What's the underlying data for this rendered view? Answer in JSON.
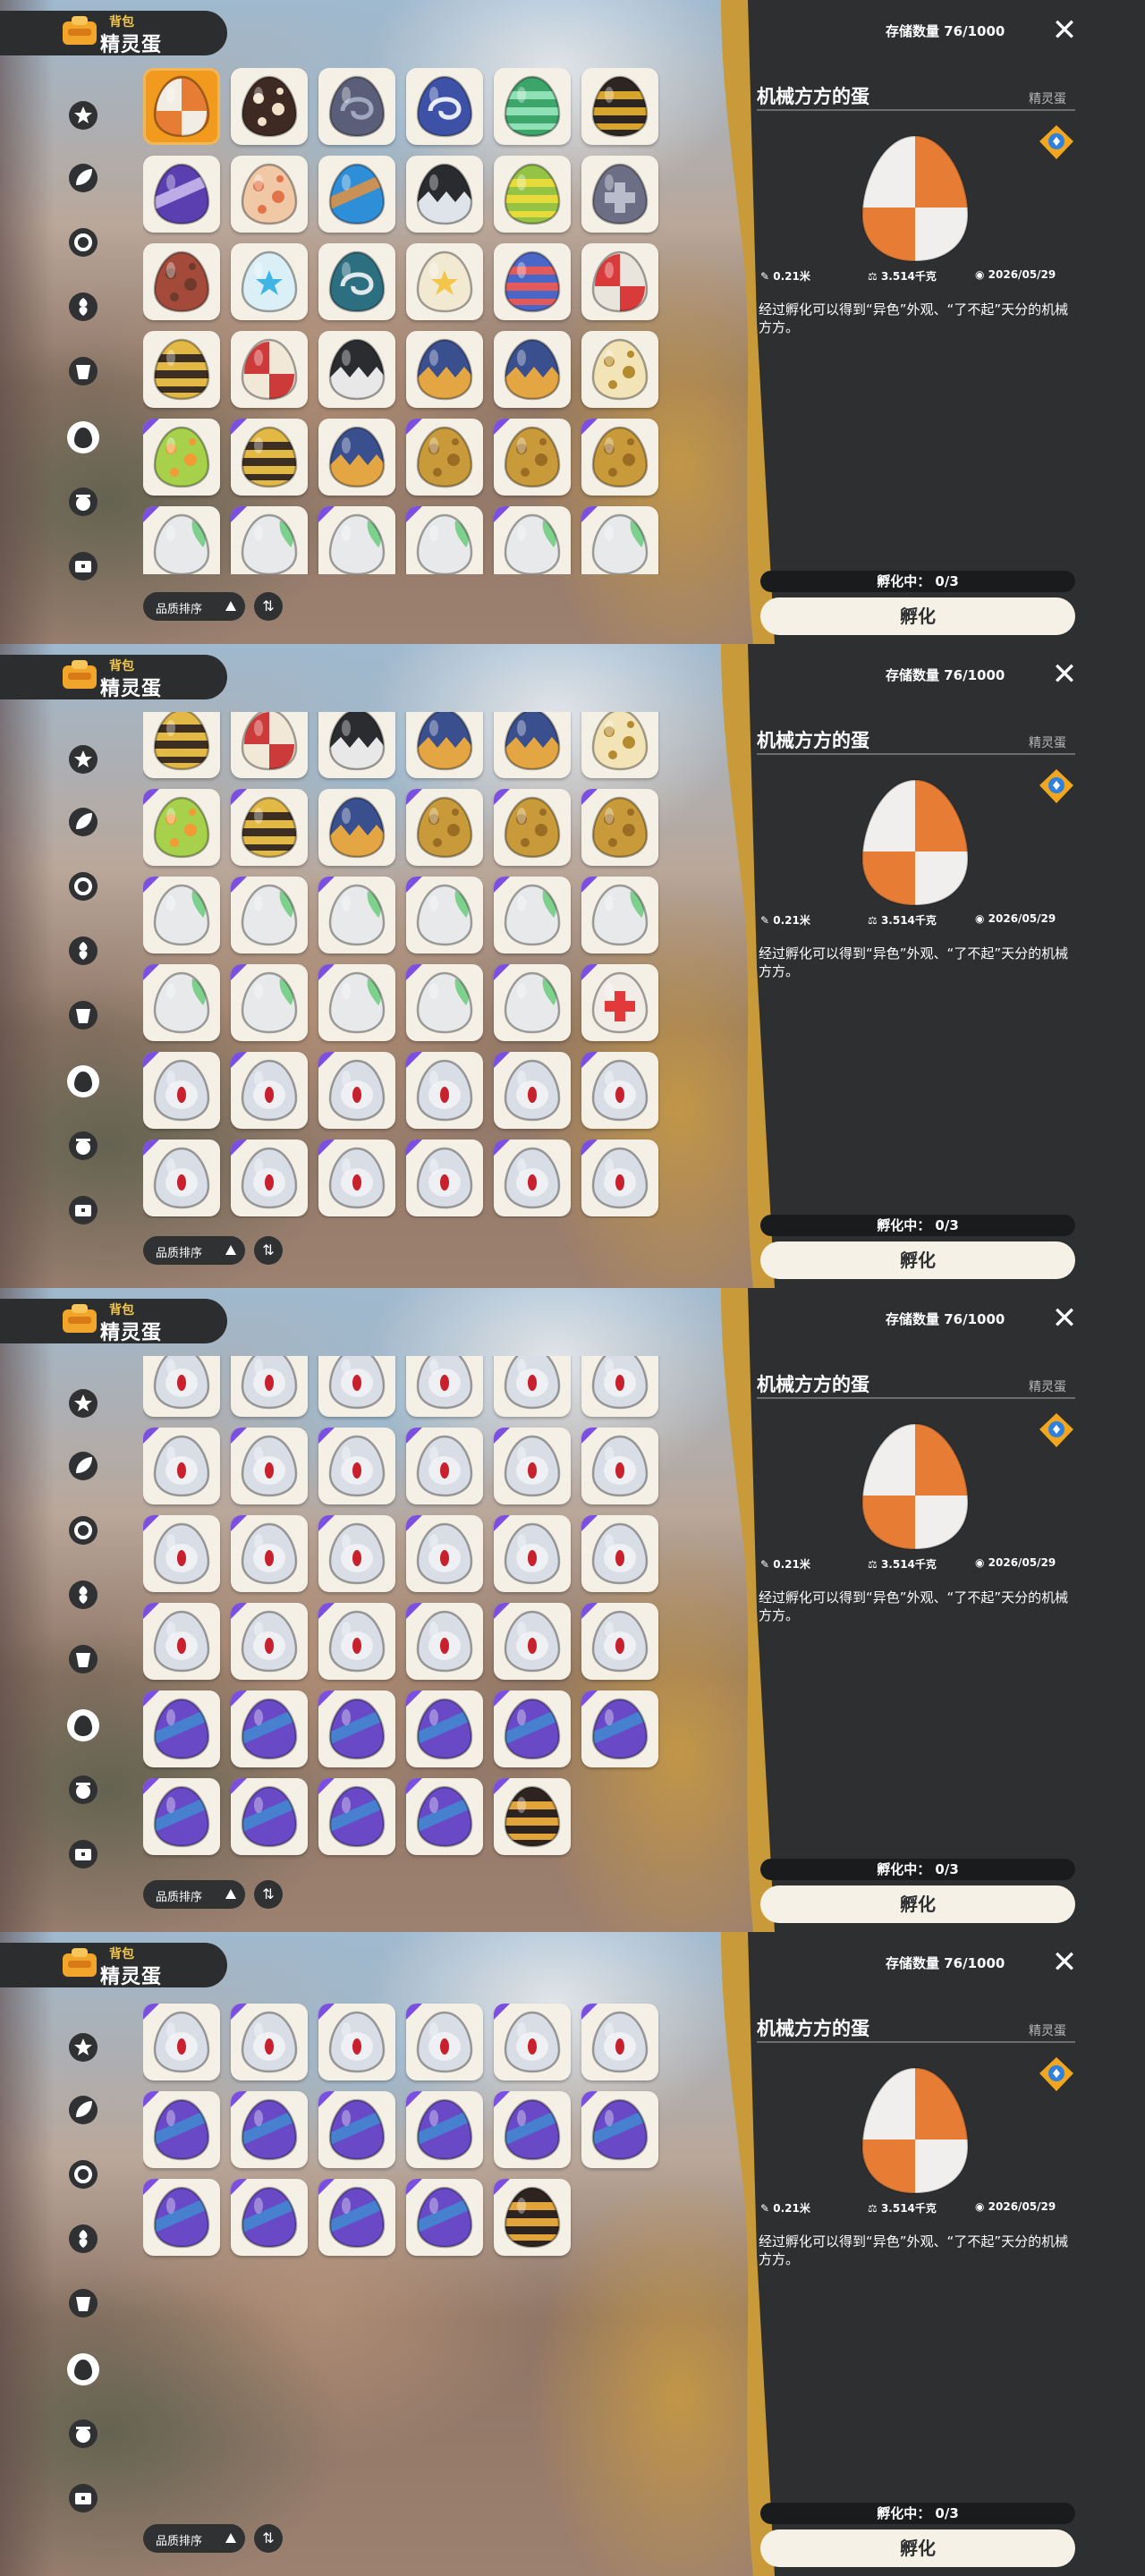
{
  "header": {
    "small": "背包",
    "big": "精灵蛋"
  },
  "nav_icons": [
    "star-badge-icon",
    "leaf-ring-icon",
    "gear-badge-icon",
    "flower-icon",
    "bucket-icon",
    "egg-tab-icon",
    "ball-icon",
    "chest-icon"
  ],
  "sort": {
    "label": "品质排序",
    "toggle": "⇅"
  },
  "panel": {
    "storage": "存储数量 76/1000",
    "close": "✕",
    "egg_name": "机械方方的蛋",
    "category": "精灵蛋",
    "stats": {
      "size": "0.21米",
      "weight": "3.514千克",
      "date": "2026/05/29"
    },
    "description": "经过孵化可以得到“异色”外观、“了不起”天分的机械方方。",
    "hatching": "孵化中： 0/3",
    "hatch_button": "孵化"
  },
  "colors": {
    "panel": "#2d2f31",
    "accent": "#f29a1e",
    "cell": "#f4f0e6",
    "rare_corner": "#7b4fe0"
  },
  "eggs": [
    {
      "c": "#e77d35",
      "b": "#f1ede4",
      "p": "checker",
      "sel": true,
      "badge": true
    },
    {
      "c": "#3e2a22",
      "b": "#f3e2c9",
      "p": "spots",
      "badge": true
    },
    {
      "c": "#5a5e78",
      "b": "#9fa8bf",
      "p": "swirl",
      "badge": true
    },
    {
      "c": "#3d52a6",
      "b": "#e8edf9",
      "p": "swirl",
      "badge": true
    },
    {
      "c": "#3ba56a",
      "b": "#8fe0b4",
      "p": "stripe",
      "badge": true
    },
    {
      "c": "#2d2521",
      "b": "#d8a52c",
      "p": "stripe",
      "badge": true
    },
    {
      "c": "#5b3fb0",
      "b": "#d3c8f5",
      "p": "diag",
      "badge": true
    },
    {
      "c": "#f0c8a6",
      "b": "#e2744a",
      "p": "spots",
      "badge": true
    },
    {
      "c": "#2f8ed8",
      "b": "#f09234",
      "p": "diag",
      "badge": true
    },
    {
      "c": "#2a2b2f",
      "b": "#dfe3ea",
      "p": "zig",
      "badge": true
    },
    {
      "c": "#95c444",
      "b": "#e6db3a",
      "p": "stripe",
      "badge": true
    },
    {
      "c": "#6b6e84",
      "b": "#b8bccb",
      "p": "cross",
      "badge": true
    },
    {
      "c": "#a34a3a",
      "b": "#6e3a2b",
      "p": "spots",
      "badge": true
    },
    {
      "c": "#dbeff7",
      "b": "#40b5e3",
      "p": "star",
      "badge": true
    },
    {
      "c": "#2b6f80",
      "b": "#dfe8ea",
      "p": "swirl",
      "badge": true
    },
    {
      "c": "#f2e9d3",
      "b": "#f3c64b",
      "p": "star",
      "badge": true
    },
    {
      "c": "#4a67c7",
      "b": "#e35a5a",
      "p": "stripe",
      "badge": true
    },
    {
      "c": "#e9e4dc",
      "b": "#d93b3b",
      "p": "checker",
      "badge": true
    },
    {
      "c": "#e3b946",
      "b": "#3c2e22",
      "p": "stripe",
      "badge": true
    },
    {
      "c": "#f2e8d8",
      "b": "#cd3a3a",
      "p": "checker",
      "badge": true
    },
    {
      "c": "#2b2c30",
      "b": "#e8e8e8",
      "p": "zig",
      "badge": true
    },
    {
      "c": "#3a4f8e",
      "b": "#e4a543",
      "p": "zig",
      "badge": true
    },
    {
      "c": "#3a4f8e",
      "b": "#e4a543",
      "p": "zig",
      "badge": true
    },
    {
      "c": "#f2e4b6",
      "b": "#b58b2f",
      "p": "spots",
      "badge": true
    },
    {
      "c": "#a7d14b",
      "b": "#f29a36",
      "p": "spots",
      "tri": true
    },
    {
      "c": "#e3b946",
      "b": "#3c2e22",
      "p": "stripe",
      "tri": true
    },
    {
      "c": "#3a4f8e",
      "b": "#e4a543",
      "p": "zig",
      "badge": true
    },
    {
      "c": "#c89a3a",
      "b": "#9b6d24",
      "p": "spots",
      "tri": true
    },
    {
      "c": "#c89a3a",
      "b": "#9b6d24",
      "p": "spots",
      "tri": true
    },
    {
      "c": "#c89a3a",
      "b": "#9b6d24",
      "p": "spots",
      "tri": true
    },
    {
      "c": "#e7e9eb",
      "b": "#7ed08d",
      "p": "leaf",
      "tri": true
    },
    {
      "c": "#e7e9eb",
      "b": "#7ed08d",
      "p": "leaf",
      "tri": true
    },
    {
      "c": "#e7e9eb",
      "b": "#7ed08d",
      "p": "leaf",
      "tri": true
    },
    {
      "c": "#e7e9eb",
      "b": "#7ed08d",
      "p": "leaf",
      "tri": true
    },
    {
      "c": "#e7e9eb",
      "b": "#7ed08d",
      "p": "leaf",
      "tri": true
    },
    {
      "c": "#e7e9eb",
      "b": "#7ed08d",
      "p": "leaf",
      "tri": true
    },
    {
      "c": "#e7e9eb",
      "b": "#7ed08d",
      "p": "leaf",
      "tri": true
    },
    {
      "c": "#e7e9eb",
      "b": "#7ed08d",
      "p": "leaf",
      "tri": true
    },
    {
      "c": "#e7e9eb",
      "b": "#7ed08d",
      "p": "leaf",
      "tri": true
    },
    {
      "c": "#e7e9eb",
      "b": "#7ed08d",
      "p": "leaf",
      "tri": true
    },
    {
      "c": "#e7e9eb",
      "b": "#7ed08d",
      "p": "leaf",
      "tri": true
    },
    {
      "c": "#f2ece6",
      "b": "#e23a3a",
      "p": "cross",
      "tri": true
    },
    {
      "c": "#d9dde6",
      "b": "#c8202c",
      "p": "dot",
      "tri": true
    },
    {
      "c": "#d9dde6",
      "b": "#c8202c",
      "p": "dot",
      "tri": true
    },
    {
      "c": "#d9dde6",
      "b": "#c8202c",
      "p": "dot",
      "tri": true
    },
    {
      "c": "#d9dde6",
      "b": "#c8202c",
      "p": "dot",
      "tri": true
    },
    {
      "c": "#d9dde6",
      "b": "#c8202c",
      "p": "dot",
      "tri": true
    },
    {
      "c": "#d9dde6",
      "b": "#c8202c",
      "p": "dot",
      "tri": true
    }
  ],
  "dot_count": 30,
  "purple_count": 10,
  "last_egg": {
    "c": "#2e241f",
    "b": "#e1a43b",
    "p": "stripe",
    "tri": true
  },
  "frames": [
    {
      "grid_offset_row": 0
    },
    {
      "grid_offset_row": 3.12
    },
    {
      "grid_offset_row": 7.18
    },
    {
      "grid_offset_row": 9.96
    }
  ]
}
